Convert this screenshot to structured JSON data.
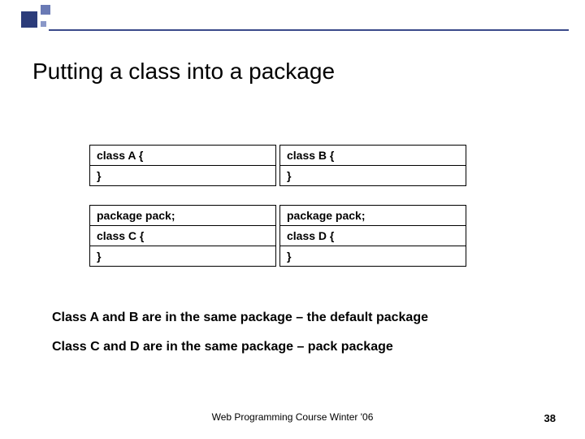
{
  "title": "Putting a class into a package",
  "boxes": {
    "topLeft": [
      "class A {",
      "}"
    ],
    "topRight": [
      "class B {",
      "}"
    ],
    "bottomLeft": [
      "package pack;",
      "class C {",
      "}"
    ],
    "bottomRight": [
      "package pack;",
      "class D {",
      "}"
    ]
  },
  "notes": {
    "line1": "Class A and B are in the same package – the default package",
    "line2": "Class C and D are in the same package – pack package"
  },
  "footer": "Web Programming Course Winter '06",
  "pageNumber": "38"
}
